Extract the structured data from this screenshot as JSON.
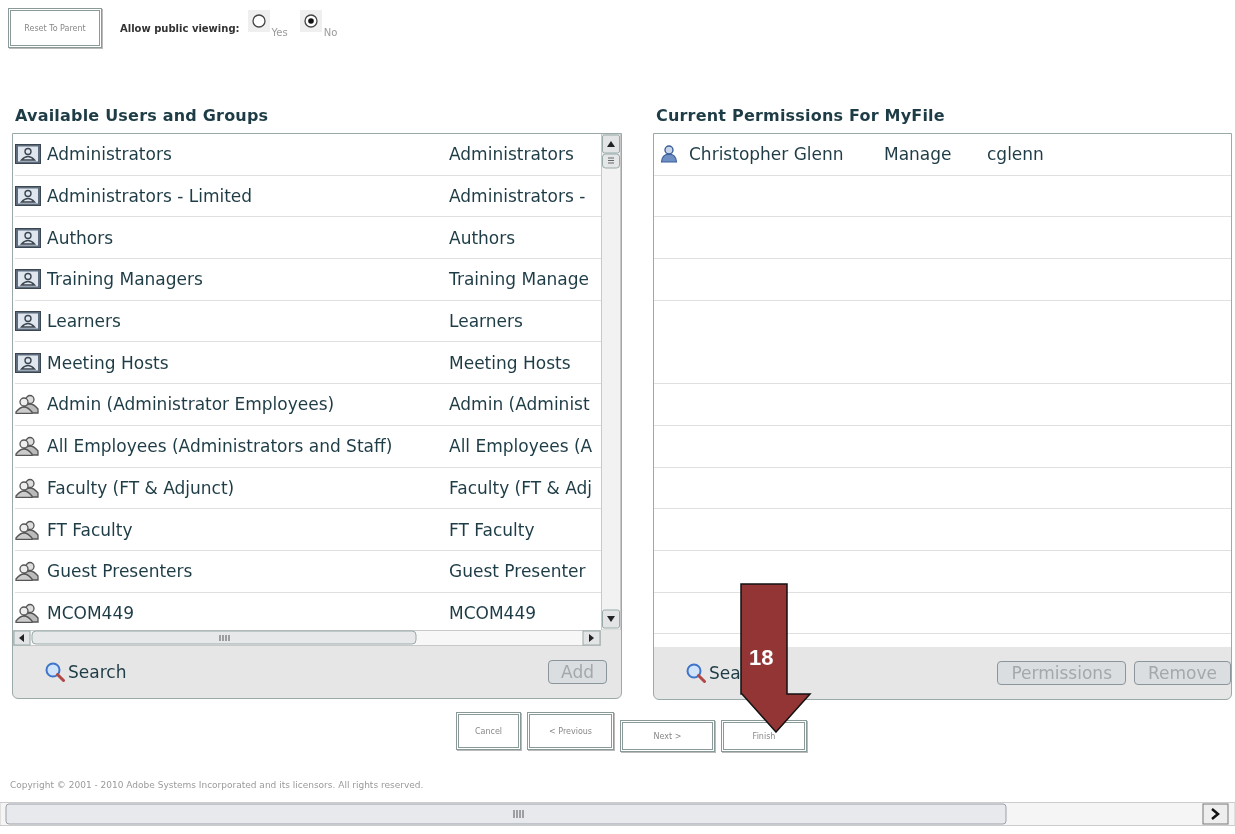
{
  "top": {
    "reset_button": "Reset To Parent",
    "public_viewing": {
      "label": "Allow public viewing:",
      "options": [
        {
          "label": "Yes",
          "selected": false
        },
        {
          "label": "No",
          "selected": true
        }
      ]
    }
  },
  "available": {
    "title": "Available Users and Groups",
    "rows": [
      {
        "kind": "role",
        "name": "Administrators",
        "column_2": "Administrators"
      },
      {
        "kind": "role",
        "name": "Administrators - Limited",
        "column_2": "Administrators -"
      },
      {
        "kind": "role",
        "name": "Authors",
        "column_2": "Authors"
      },
      {
        "kind": "role",
        "name": "Training Managers",
        "column_2": "Training Manage"
      },
      {
        "kind": "role",
        "name": "Learners",
        "column_2": "Learners"
      },
      {
        "kind": "role",
        "name": "Meeting Hosts",
        "column_2": "Meeting Hosts"
      },
      {
        "kind": "group",
        "name": "Admin (Administrator Employees)",
        "column_2": "Admin (Administ"
      },
      {
        "kind": "group",
        "name": "All Employees (Administrators and Staff)",
        "column_2": "All Employees (A"
      },
      {
        "kind": "group",
        "name": "Faculty (FT & Adjunct)",
        "column_2": "Faculty (FT & Adj"
      },
      {
        "kind": "group",
        "name": "FT Faculty",
        "column_2": "FT Faculty"
      },
      {
        "kind": "group",
        "name": "Guest Presenters",
        "column_2": "Guest Presenter"
      },
      {
        "kind": "group",
        "name": "MCOM449",
        "column_2": "MCOM449"
      }
    ],
    "search": "Search",
    "add_button": {
      "label": "Add",
      "disabled": true
    }
  },
  "permissions": {
    "title": "Current Permissions For MyFile",
    "rows": [
      {
        "kind": "user",
        "name": "Christopher Glenn",
        "permission": "Manage",
        "login": "cglenn"
      }
    ],
    "search": "Sea",
    "buttons": [
      {
        "label": "Permissions",
        "disabled": true
      },
      {
        "label": "Remove",
        "disabled": true
      }
    ]
  },
  "wizard_buttons": [
    {
      "label": "Cancel"
    },
    {
      "label": "< Previous"
    },
    {
      "label": "Next >"
    },
    {
      "label": "Finish"
    }
  ],
  "copyright": "Copyright © 2001 - 2010 Adobe Systems Incorporated and its licensors. All rights reserved.",
  "annotation": {
    "number": "18"
  }
}
